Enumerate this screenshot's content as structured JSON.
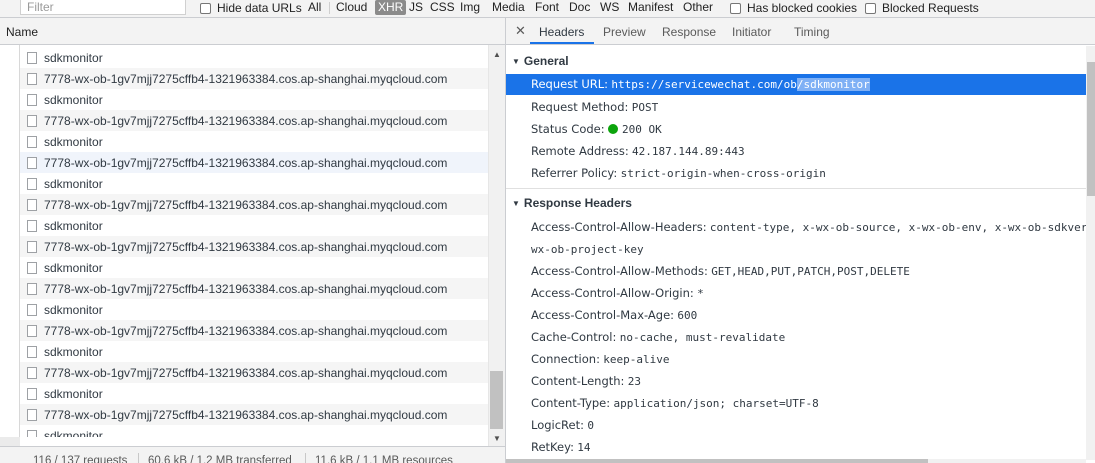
{
  "toolbar": {
    "filter_placeholder": "Filter",
    "hide_data_urls": "Hide data URLs",
    "types": [
      "All",
      "Cloud",
      "XHR",
      "JS",
      "CSS",
      "Img",
      "Media",
      "Font",
      "Doc",
      "WS",
      "Manifest",
      "Other"
    ],
    "selected_type": "XHR",
    "has_blocked_cookies": "Has blocked cookies",
    "blocked_requests": "Blocked Requests"
  },
  "list": {
    "column_name": "Name",
    "rows": [
      "sdkmonitor",
      "7778-wx-ob-1gv7mjj7275cffb4-1321963384.cos.ap-shanghai.myqcloud.com",
      "sdkmonitor",
      "7778-wx-ob-1gv7mjj7275cffb4-1321963384.cos.ap-shanghai.myqcloud.com",
      "sdkmonitor",
      "7778-wx-ob-1gv7mjj7275cffb4-1321963384.cos.ap-shanghai.myqcloud.com",
      "sdkmonitor",
      "7778-wx-ob-1gv7mjj7275cffb4-1321963384.cos.ap-shanghai.myqcloud.com",
      "sdkmonitor",
      "7778-wx-ob-1gv7mjj7275cffb4-1321963384.cos.ap-shanghai.myqcloud.com",
      "sdkmonitor",
      "7778-wx-ob-1gv7mjj7275cffb4-1321963384.cos.ap-shanghai.myqcloud.com",
      "sdkmonitor",
      "7778-wx-ob-1gv7mjj7275cffb4-1321963384.cos.ap-shanghai.myqcloud.com",
      "sdkmonitor",
      "7778-wx-ob-1gv7mjj7275cffb4-1321963384.cos.ap-shanghai.myqcloud.com",
      "sdkmonitor",
      "7778-wx-ob-1gv7mjj7275cffb4-1321963384.cos.ap-shanghai.myqcloud.com",
      "sdkmonitor"
    ]
  },
  "status": {
    "requests": "116 / 137 requests",
    "transferred": "60.6 kB / 1.2 MB transferred",
    "resources": "11.6 kB / 1.1 MB resources"
  },
  "tabs": {
    "close": "✕",
    "items": [
      "Headers",
      "Preview",
      "Response",
      "Initiator",
      "Timing"
    ],
    "active": "Headers"
  },
  "general": {
    "title": "General",
    "request_url_name": "Request URL:",
    "request_url_value_a": "https://servicewechat.com/ob",
    "request_url_value_b": "/sdkmonitor",
    "request_method_name": "Request Method:",
    "request_method_value": "POST",
    "status_code_name": "Status Code:",
    "status_code_value": "200 OK",
    "remote_address_name": "Remote Address:",
    "remote_address_value": "42.187.144.89:443",
    "referrer_policy_name": "Referrer Policy:",
    "referrer_policy_value": "strict-origin-when-cross-origin"
  },
  "response": {
    "title": "Response Headers",
    "acah_name": "Access-Control-Allow-Headers:",
    "acah_value": "content-type, x-wx-ob-source, x-wx-ob-env, x-wx-ob-sdkver",
    "acah_value_cont": "wx-ob-project-key",
    "acam_name": "Access-Control-Allow-Methods:",
    "acam_value": "GET,HEAD,PUT,PATCH,POST,DELETE",
    "acao_name": "Access-Control-Allow-Origin:",
    "acao_value": "*",
    "acma_name": "Access-Control-Max-Age:",
    "acma_value": "600",
    "cache_name": "Cache-Control:",
    "cache_value": "no-cache, must-revalidate",
    "conn_name": "Connection:",
    "conn_value": "keep-alive",
    "clen_name": "Content-Length:",
    "clen_value": "23",
    "ctype_name": "Content-Type:",
    "ctype_value": "application/json; charset=UTF-8",
    "logicret_name": "LogicRet:",
    "logicret_value": "0",
    "retkey_name": "RetKey:",
    "retkey_value": "14"
  },
  "colors": {
    "selection": "#1a73e8",
    "status_green": "#0ca40c",
    "panel_bg": "#f3f3f3"
  }
}
